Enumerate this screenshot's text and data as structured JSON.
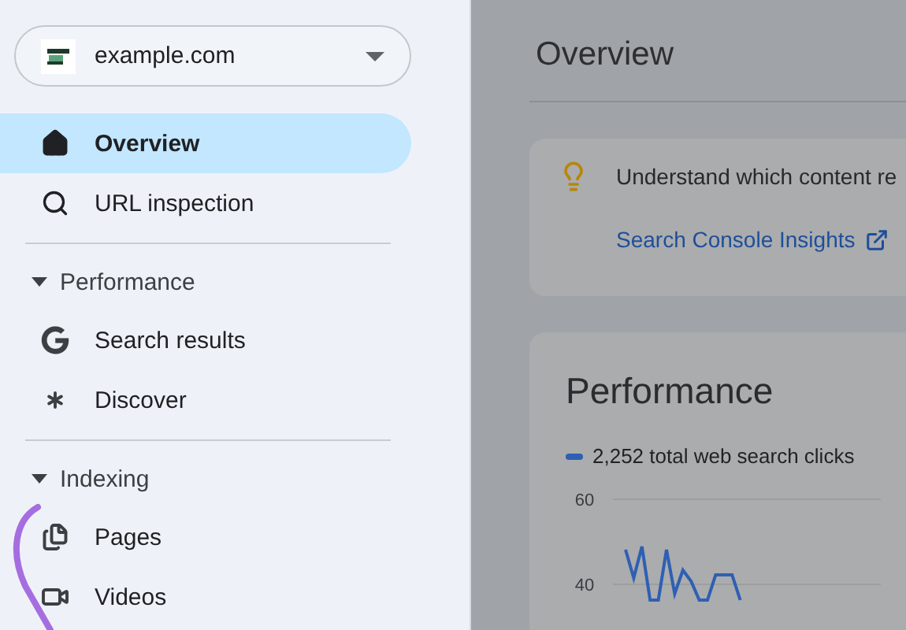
{
  "property": {
    "name": "example.com"
  },
  "nav": [
    {
      "kind": "item",
      "label": "Overview",
      "selected": true
    },
    {
      "kind": "item",
      "label": "URL inspection",
      "selected": false
    },
    {
      "kind": "section",
      "label": "Performance",
      "expanded": true,
      "children": [
        {
          "label": "Search results",
          "selected": false
        },
        {
          "label": "Discover",
          "selected": false
        }
      ]
    },
    {
      "kind": "section",
      "label": "Indexing",
      "expanded": true,
      "children": [
        {
          "label": "Pages",
          "selected": false
        },
        {
          "label": "Videos",
          "selected": false
        }
      ]
    }
  ],
  "main": {
    "title": "Overview",
    "insight": {
      "text": "Understand which content re",
      "link": "Search Console Insights"
    },
    "performance": {
      "title": "Performance",
      "legend": "2,252 total web search clicks",
      "y_axis_labels": [
        "60",
        "40"
      ]
    }
  }
}
